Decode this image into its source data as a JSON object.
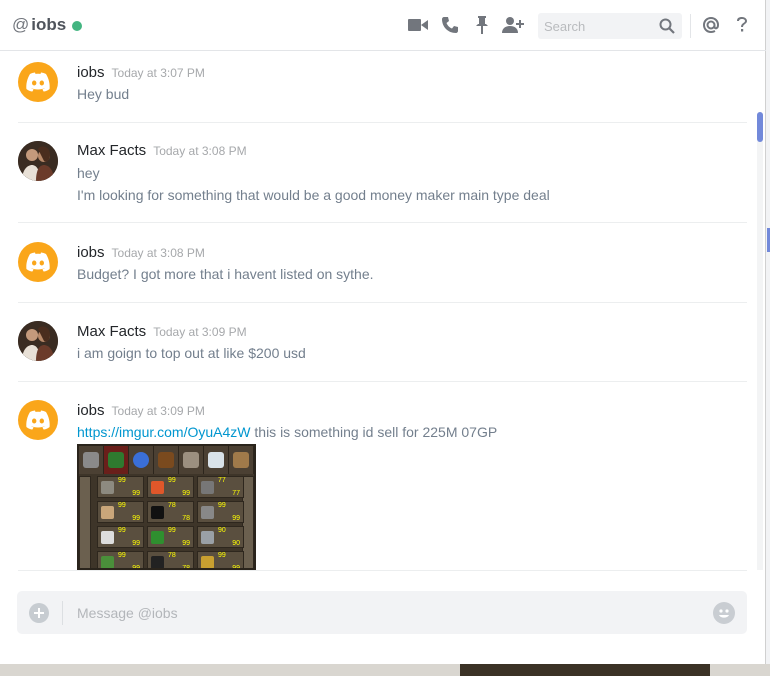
{
  "header": {
    "at_symbol": "@",
    "channel_name": "iobs",
    "status_color": "#43b581",
    "search_placeholder": "Search",
    "icons": [
      "video-call-icon",
      "phone-call-icon",
      "pin-icon",
      "add-friend-icon",
      "search-icon",
      "mention-icon",
      "help-icon"
    ]
  },
  "messages": [
    {
      "author": "iobs",
      "timestamp": "Today at 3:07 PM",
      "lines": [
        "Hey bud"
      ]
    },
    {
      "author": "Max Facts",
      "timestamp": "Today at 3:08 PM",
      "lines": [
        "hey",
        "I'm looking for something that would be a good money maker main type deal"
      ]
    },
    {
      "author": "iobs",
      "timestamp": "Today at 3:08 PM",
      "lines": [
        "Budget? I got more that i havent listed on sythe."
      ]
    },
    {
      "author": "Max Facts",
      "timestamp": "Today at 3:09 PM",
      "lines": [
        "i am goign to top out at like $200 usd"
      ]
    },
    {
      "author": "iobs",
      "timestamp": "Today at 3:09 PM",
      "link": "https://imgur.com/OyuA4zW",
      "text_after_link": " this is something id sell for 225M 07GP"
    }
  ],
  "composer": {
    "placeholder": "Message @iobs"
  },
  "colors": {
    "accent": "#7289da",
    "link": "#0096cf",
    "discord_avatar": "#faa61a"
  }
}
